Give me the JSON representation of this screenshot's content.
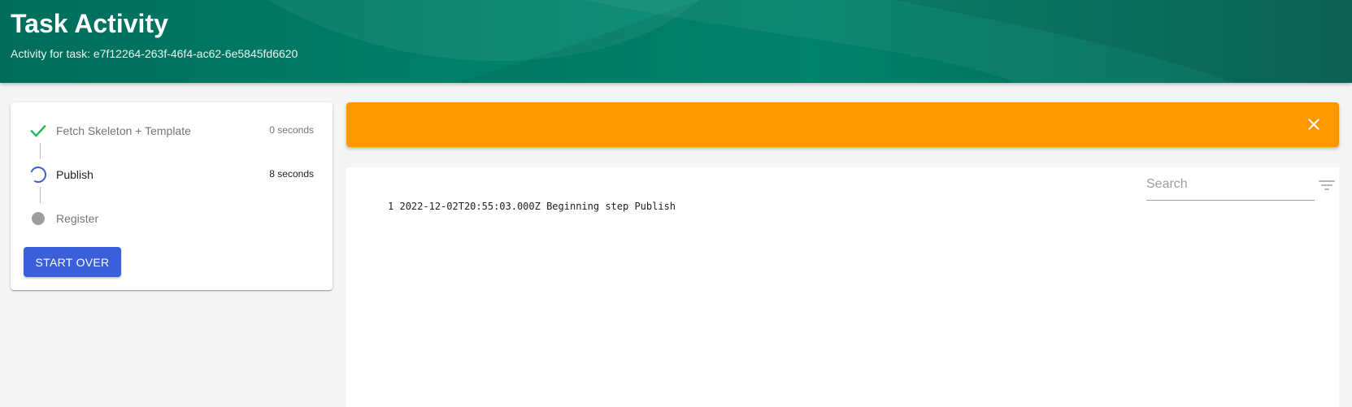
{
  "header": {
    "title": "Task Activity",
    "subtitle": "Activity for task: e7f12264-263f-46f4-ac62-6e5845fd6620"
  },
  "steps": [
    {
      "label": "Fetch Skeleton + Template",
      "duration": "0 seconds",
      "status": "completed",
      "icon": "check-icon"
    },
    {
      "label": "Publish",
      "duration": "8 seconds",
      "status": "in-progress",
      "icon": "spinner-icon"
    },
    {
      "label": "Register",
      "duration": "",
      "status": "pending",
      "icon": "pending-dot-icon"
    }
  ],
  "actions": {
    "start_over_label": "START OVER"
  },
  "alert": {
    "message": "",
    "color": "#ff9800",
    "close_icon": "close-icon"
  },
  "log": {
    "search_placeholder": "Search",
    "filter_icon": "filter-icon",
    "lines": [
      {
        "number": "1",
        "text": "2022-12-02T20:55:03.000Z Beginning step Publish"
      }
    ]
  },
  "colors": {
    "header": "#00806b",
    "primary_button": "#3b5fd9",
    "success": "#1db954",
    "spinner": "#3b5fd9",
    "pending": "#9e9e9e",
    "warning": "#ff9800"
  }
}
